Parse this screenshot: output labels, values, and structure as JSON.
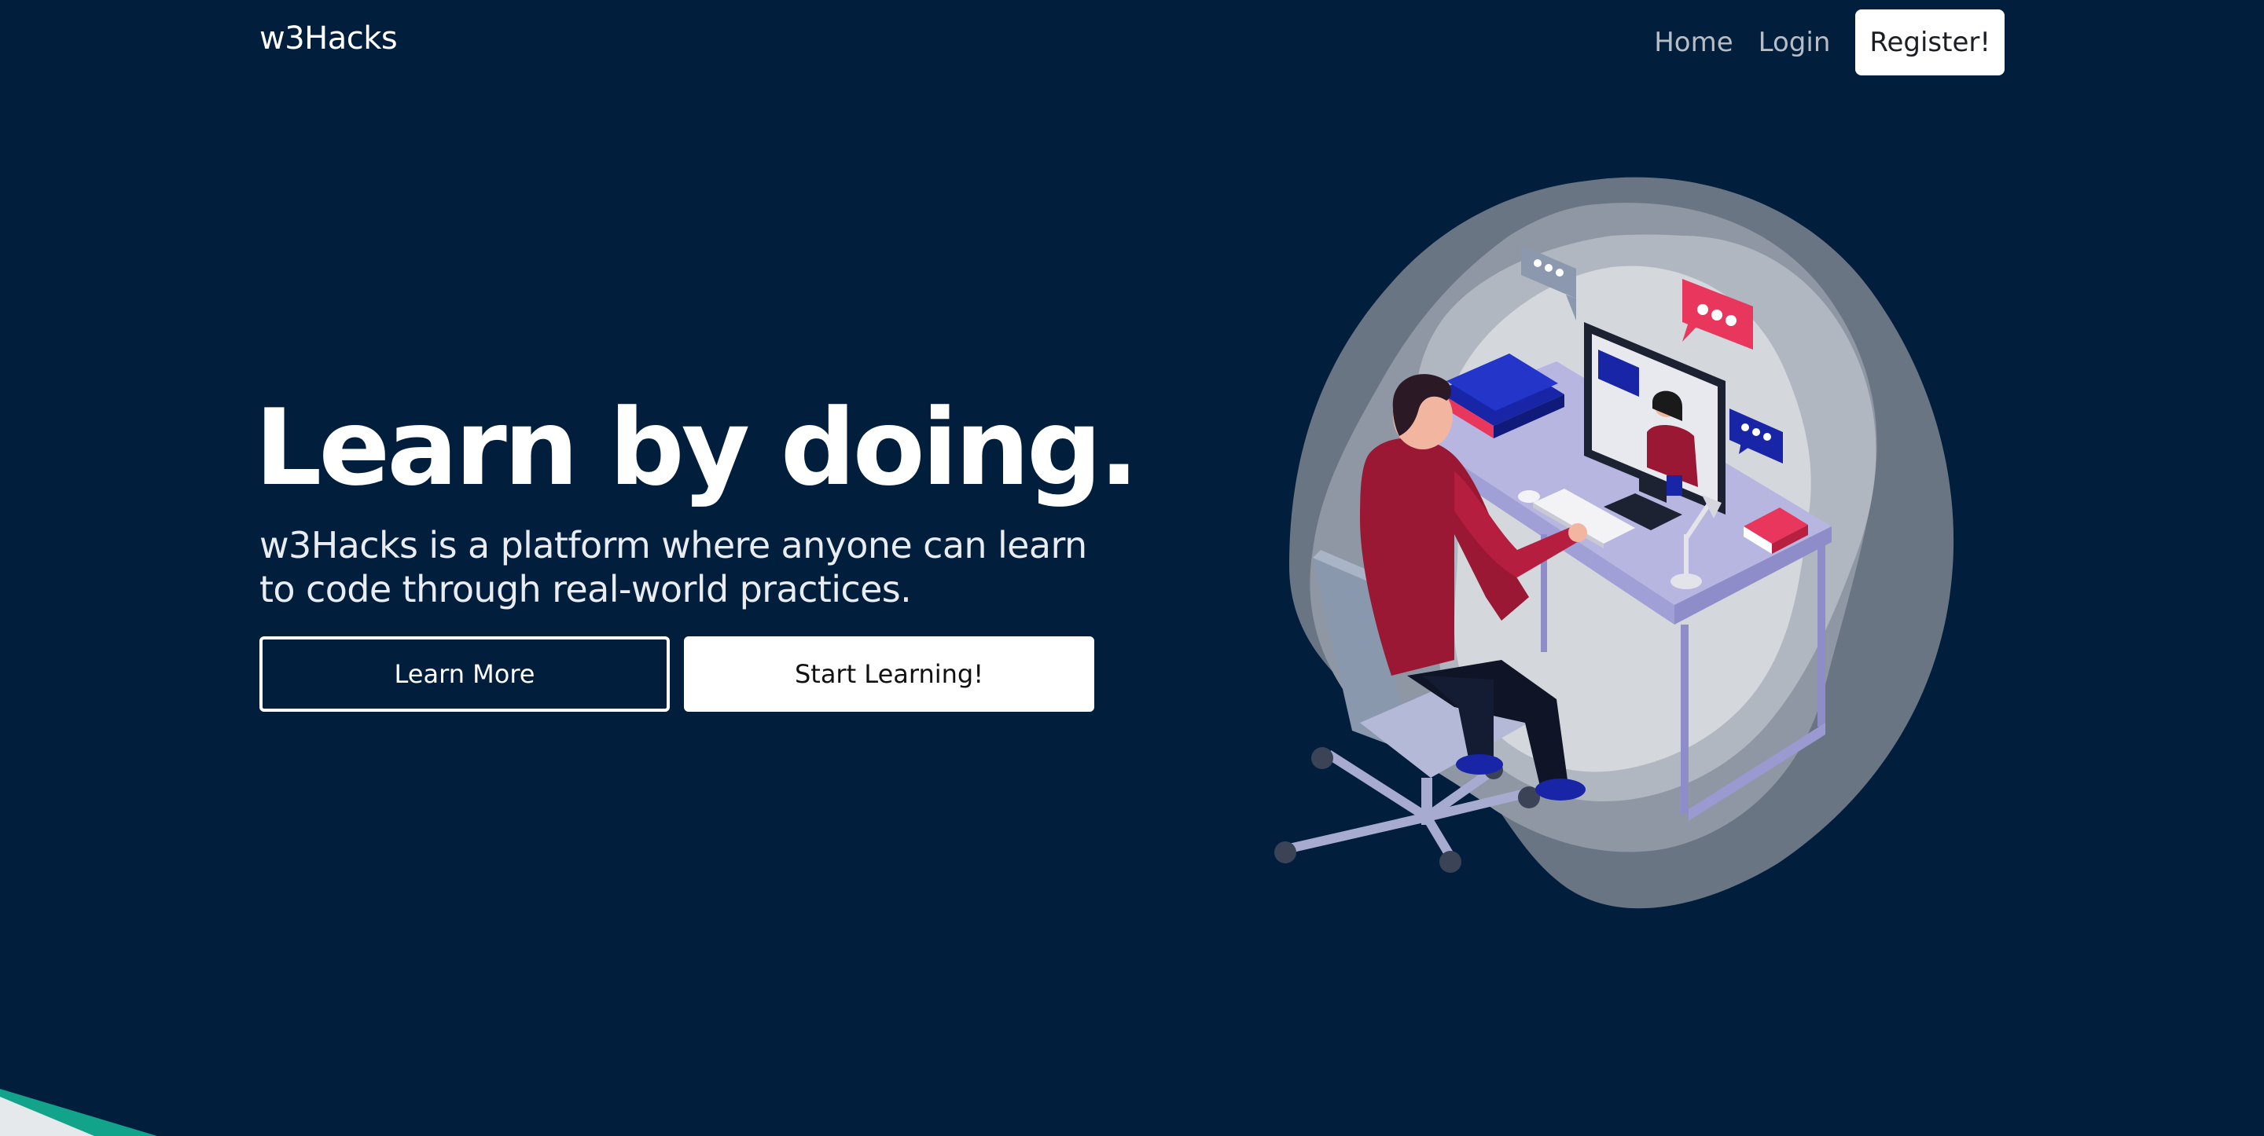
{
  "navbar": {
    "brand": "w3Hacks",
    "links": [
      "Home",
      "Login"
    ],
    "register_label": "Register!"
  },
  "hero": {
    "title": "Learn by doing.",
    "subtitle": "w3Hacks is a platform where anyone can learn to code through real-world practices.",
    "learn_more_label": "Learn More",
    "start_label": "Start Learning!"
  },
  "colors": {
    "background": "#011f3d",
    "accent_teal": "#12a48a",
    "accent_red": "#e8365d",
    "shirt": "#9a1834"
  },
  "illustration": {
    "description_icons": [
      "speech-bubble-icon",
      "monitor-icon",
      "desk-chair-icon",
      "books-icon",
      "lamp-icon",
      "keyboard-icon"
    ]
  }
}
